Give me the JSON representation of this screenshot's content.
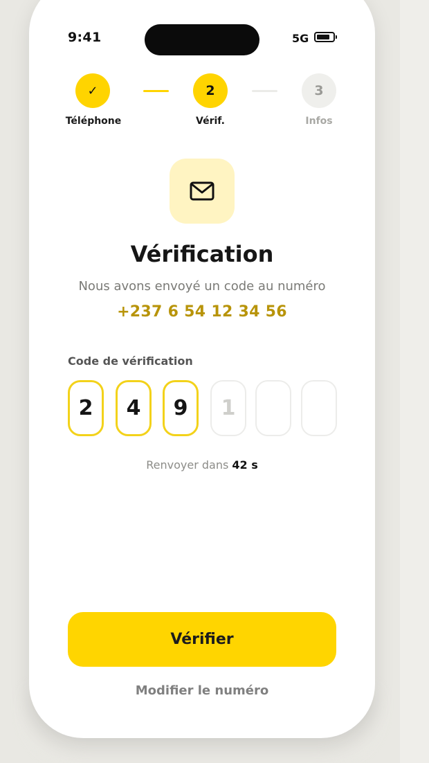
{
  "status": {
    "time": "9:41",
    "network": "5G"
  },
  "stepper": {
    "steps": [
      {
        "label": "Téléphone",
        "marker": "✓",
        "state": "done"
      },
      {
        "label": "Vérif.",
        "marker": "2",
        "state": "current"
      },
      {
        "label": "Infos",
        "marker": "3",
        "state": "upcoming"
      }
    ]
  },
  "header": {
    "icon": "mail-icon",
    "title": "Vérification",
    "subtitle": "Nous avons envoyé un code au numéro",
    "phone_number": "+237 6 54 12 34 56"
  },
  "code": {
    "label": "Code de vérification",
    "digits": [
      "2",
      "4",
      "9",
      "",
      "",
      ""
    ],
    "placeholder_digit": "1"
  },
  "resend": {
    "prefix": "Renvoyer dans ",
    "countdown": "42 s"
  },
  "actions": {
    "verify_label": "Vérifier",
    "modify_label": "Modifier le numéro"
  },
  "colors": {
    "accent": "#FFD400",
    "accent_light": "#FFF4C2",
    "phone_text": "#B8940A",
    "background": "#e9e8e3"
  }
}
